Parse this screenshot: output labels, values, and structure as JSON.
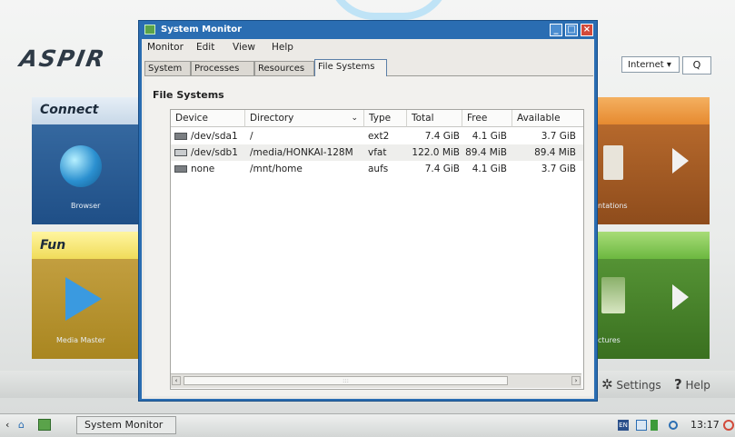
{
  "desktop": {
    "logo": "ASPIR",
    "search": {
      "engine": "Internet",
      "go_label": "Q"
    },
    "panels": {
      "connect": {
        "title": "Connect",
        "app": "Browser"
      },
      "fun": {
        "title": "Fun",
        "app": "Media Master"
      },
      "right_top_label": "ntations",
      "right_bottom_label": "ctures"
    },
    "footer": {
      "settings": "Settings",
      "help": "Help"
    }
  },
  "window": {
    "title": "System Monitor",
    "menu": [
      "Monitor",
      "Edit",
      "View",
      "Help"
    ],
    "tabs": [
      "System",
      "Processes",
      "Resources",
      "File Systems"
    ],
    "active_tab": "File Systems",
    "section_title": "File Systems",
    "columns": [
      "Device",
      "Directory",
      "Type",
      "Total",
      "Free",
      "Available"
    ],
    "rows": [
      {
        "device": "/dev/sda1",
        "directory": "/",
        "type": "ext2",
        "total": "7.4 GiB",
        "free": "4.1 GiB",
        "available": "3.7 GiB"
      },
      {
        "device": "/dev/sdb1",
        "directory": "/media/HONKAI-128M",
        "type": "vfat",
        "total": "122.0 MiB",
        "free": "89.4 MiB",
        "available": "89.4 MiB"
      },
      {
        "device": "none",
        "directory": "/mnt/home",
        "type": "aufs",
        "total": "7.4 GiB",
        "free": "4.1 GiB",
        "available": "3.7 GiB"
      }
    ]
  },
  "taskbar": {
    "task": "System Monitor",
    "clock": "13:17",
    "lang": "EN"
  },
  "colors": {
    "window_border": "#2a6db2",
    "close": "#d24a3a"
  }
}
